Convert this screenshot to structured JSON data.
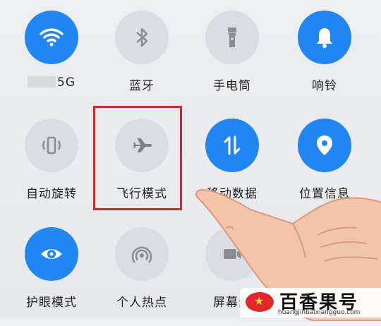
{
  "quick_settings": {
    "row1": [
      {
        "label": "5G",
        "state": "on",
        "icon": "wifi-icon"
      },
      {
        "label": "蓝牙",
        "state": "off",
        "icon": "bluetooth-icon"
      },
      {
        "label": "手电筒",
        "state": "off",
        "icon": "flashlight-icon"
      },
      {
        "label": "响铃",
        "state": "on",
        "icon": "bell-icon"
      }
    ],
    "row2": [
      {
        "label": "自动旋转",
        "state": "off",
        "icon": "rotate-icon"
      },
      {
        "label": "飞行模式",
        "state": "off",
        "icon": "airplane-icon"
      },
      {
        "label": "移动数据",
        "state": "on",
        "icon": "data-transfer-icon"
      },
      {
        "label": "位置信息",
        "state": "on",
        "icon": "location-pin-icon"
      }
    ],
    "row3": [
      {
        "label": "护眼模式",
        "state": "on",
        "icon": "eye-icon"
      },
      {
        "label": "个人热点",
        "state": "off",
        "icon": "hotspot-icon"
      },
      {
        "label": "屏幕录",
        "state": "off",
        "icon": "screen-record-icon"
      }
    ]
  },
  "colors": {
    "accent": "#1f86f3",
    "inactive": "#dadde2",
    "highlight": "#e0232a"
  },
  "watermark": {
    "text": "百香果号",
    "url": "huangjinbaixiangguo.com"
  }
}
